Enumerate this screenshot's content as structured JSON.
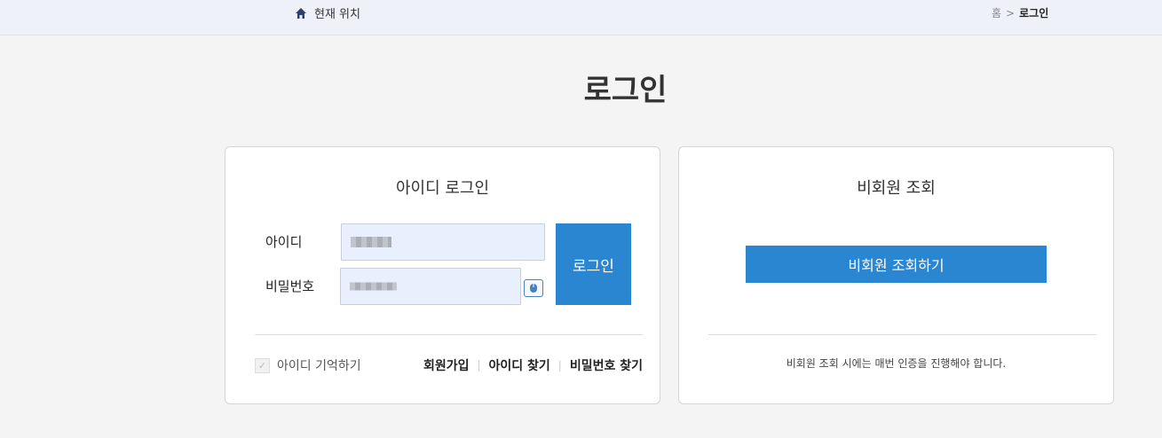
{
  "breadcrumb": {
    "current_location_label": "현재 위치",
    "home": "홈",
    "separator": ">",
    "current": "로그인"
  },
  "page_title": "로그인",
  "member_login": {
    "title": "아이디 로그인",
    "id_label": "아이디",
    "password_label": "비밀번호",
    "login_button": "로그인",
    "remember_label": "아이디 기억하기",
    "links": [
      "회원가입",
      "아이디 찾기",
      "비밀번호 찾기"
    ]
  },
  "guest_lookup": {
    "title": "비회원 조회",
    "button": "비회원 조회하기",
    "notice": "비회원 조회 시에는 매번 인증을 진행해야 합니다."
  },
  "colors": {
    "accent": "#2a86d0",
    "field_bg": "#e8f0fe",
    "topbar_bg": "#eef1f8",
    "page_bg": "#f4f4f4"
  }
}
